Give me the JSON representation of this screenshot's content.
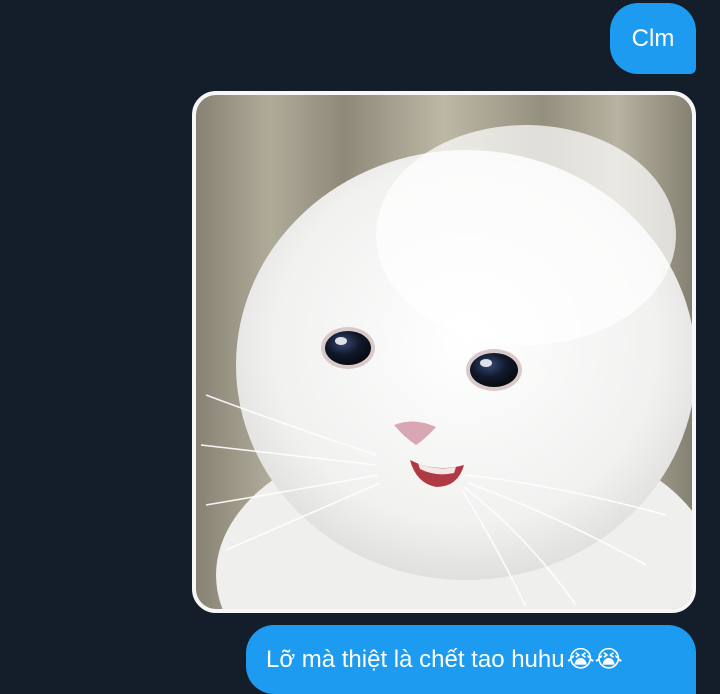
{
  "messages": [
    {
      "id": "m1",
      "direction": "outgoing",
      "type": "text",
      "text": "Clm"
    },
    {
      "id": "m2",
      "direction": "outgoing",
      "type": "image",
      "image_icon": "crying-white-cat-meme-image"
    },
    {
      "id": "m3",
      "direction": "outgoing",
      "type": "text",
      "text": "Lỡ mà thiệt là chết tao huhu",
      "emojis": "😭😭"
    }
  ],
  "colors": {
    "background": "#141d2a",
    "bubble": "#1d9bf0",
    "bubble_text": "#ffffff"
  }
}
